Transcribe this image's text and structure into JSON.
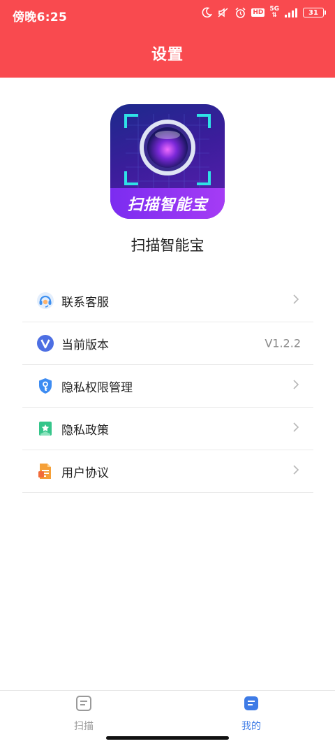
{
  "status_bar": {
    "time": "傍晚6:25",
    "network": "5G",
    "hd_badge": "HD",
    "battery": "31"
  },
  "header": {
    "title": "设置"
  },
  "app": {
    "icon_label": "扫描智能宝",
    "name": "扫描智能宝"
  },
  "menu": {
    "items": [
      {
        "label": "联系客服",
        "icon": "headset-icon"
      },
      {
        "label": "当前版本",
        "icon": "version-icon",
        "value": "V1.2.2"
      },
      {
        "label": "隐私权限管理",
        "icon": "shield-key-icon"
      },
      {
        "label": "隐私政策",
        "icon": "star-bookmark-icon"
      },
      {
        "label": "用户协议",
        "icon": "document-icon"
      }
    ]
  },
  "tabs": [
    {
      "label": "扫描",
      "active": false
    },
    {
      "label": "我的",
      "active": true
    }
  ],
  "colors": {
    "header": "#f94a4f",
    "active_tab": "#3e7be6",
    "inactive_tab": "#9a9a9a"
  }
}
